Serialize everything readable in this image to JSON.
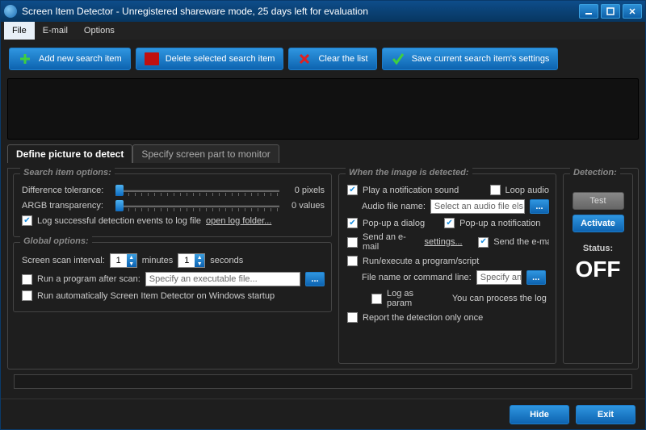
{
  "title": "Screen Item Detector - Unregistered shareware mode, 25 days left for evaluation",
  "menu": {
    "file": "File",
    "email": "E-mail",
    "options": "Options"
  },
  "toolbar": {
    "add": "Add new search item",
    "delete": "Delete selected search item",
    "clear": "Clear the list",
    "save": "Save current search item's settings"
  },
  "tabs": {
    "define": "Define picture to detect",
    "specify": "Specify screen part to monitor"
  },
  "search_opts": {
    "title": "Search item options:",
    "diff_label": "Difference tolerance:",
    "diff_value": "0 pixels",
    "argb_label": "ARGB transparency:",
    "argb_value": "0 values",
    "log_label": "Log successful detection events to log file",
    "open_log": "open log folder..."
  },
  "global_opts": {
    "title": "Global options:",
    "scan_label": "Screen scan interval:",
    "minutes_val": "1",
    "minutes_label": "minutes",
    "seconds_val": "1",
    "seconds_label": "seconds",
    "run_after_label": "Run a program after scan:",
    "run_after_placeholder": "Specify an executable file...",
    "autostart_label": "Run automatically Screen Item Detector on Windows startup"
  },
  "detected": {
    "title": "When the image is detected:",
    "play_sound": "Play a notification sound",
    "loop_audio": "Loop audio",
    "audio_label": "Audio file name:",
    "audio_placeholder": "Select an audio file els",
    "popup_dialog": "Pop-up a dialog",
    "popup_notif": "Pop-up a notification",
    "send_email": "Send an e-mail",
    "settings_link": "settings...",
    "send_the_email": "Send the e-ma",
    "run_script": "Run/execute a program/script",
    "cmd_label": "File name or command line:",
    "cmd_placeholder": "Specify an",
    "log_param": "Log as param",
    "process_log": "You can process the log afte",
    "report_once": "Report the detection only once"
  },
  "detection": {
    "title": "Detection:",
    "test": "Test",
    "activate": "Activate",
    "status_label": "Status:",
    "status_value": "OFF"
  },
  "footer": {
    "hide": "Hide",
    "exit": "Exit"
  }
}
